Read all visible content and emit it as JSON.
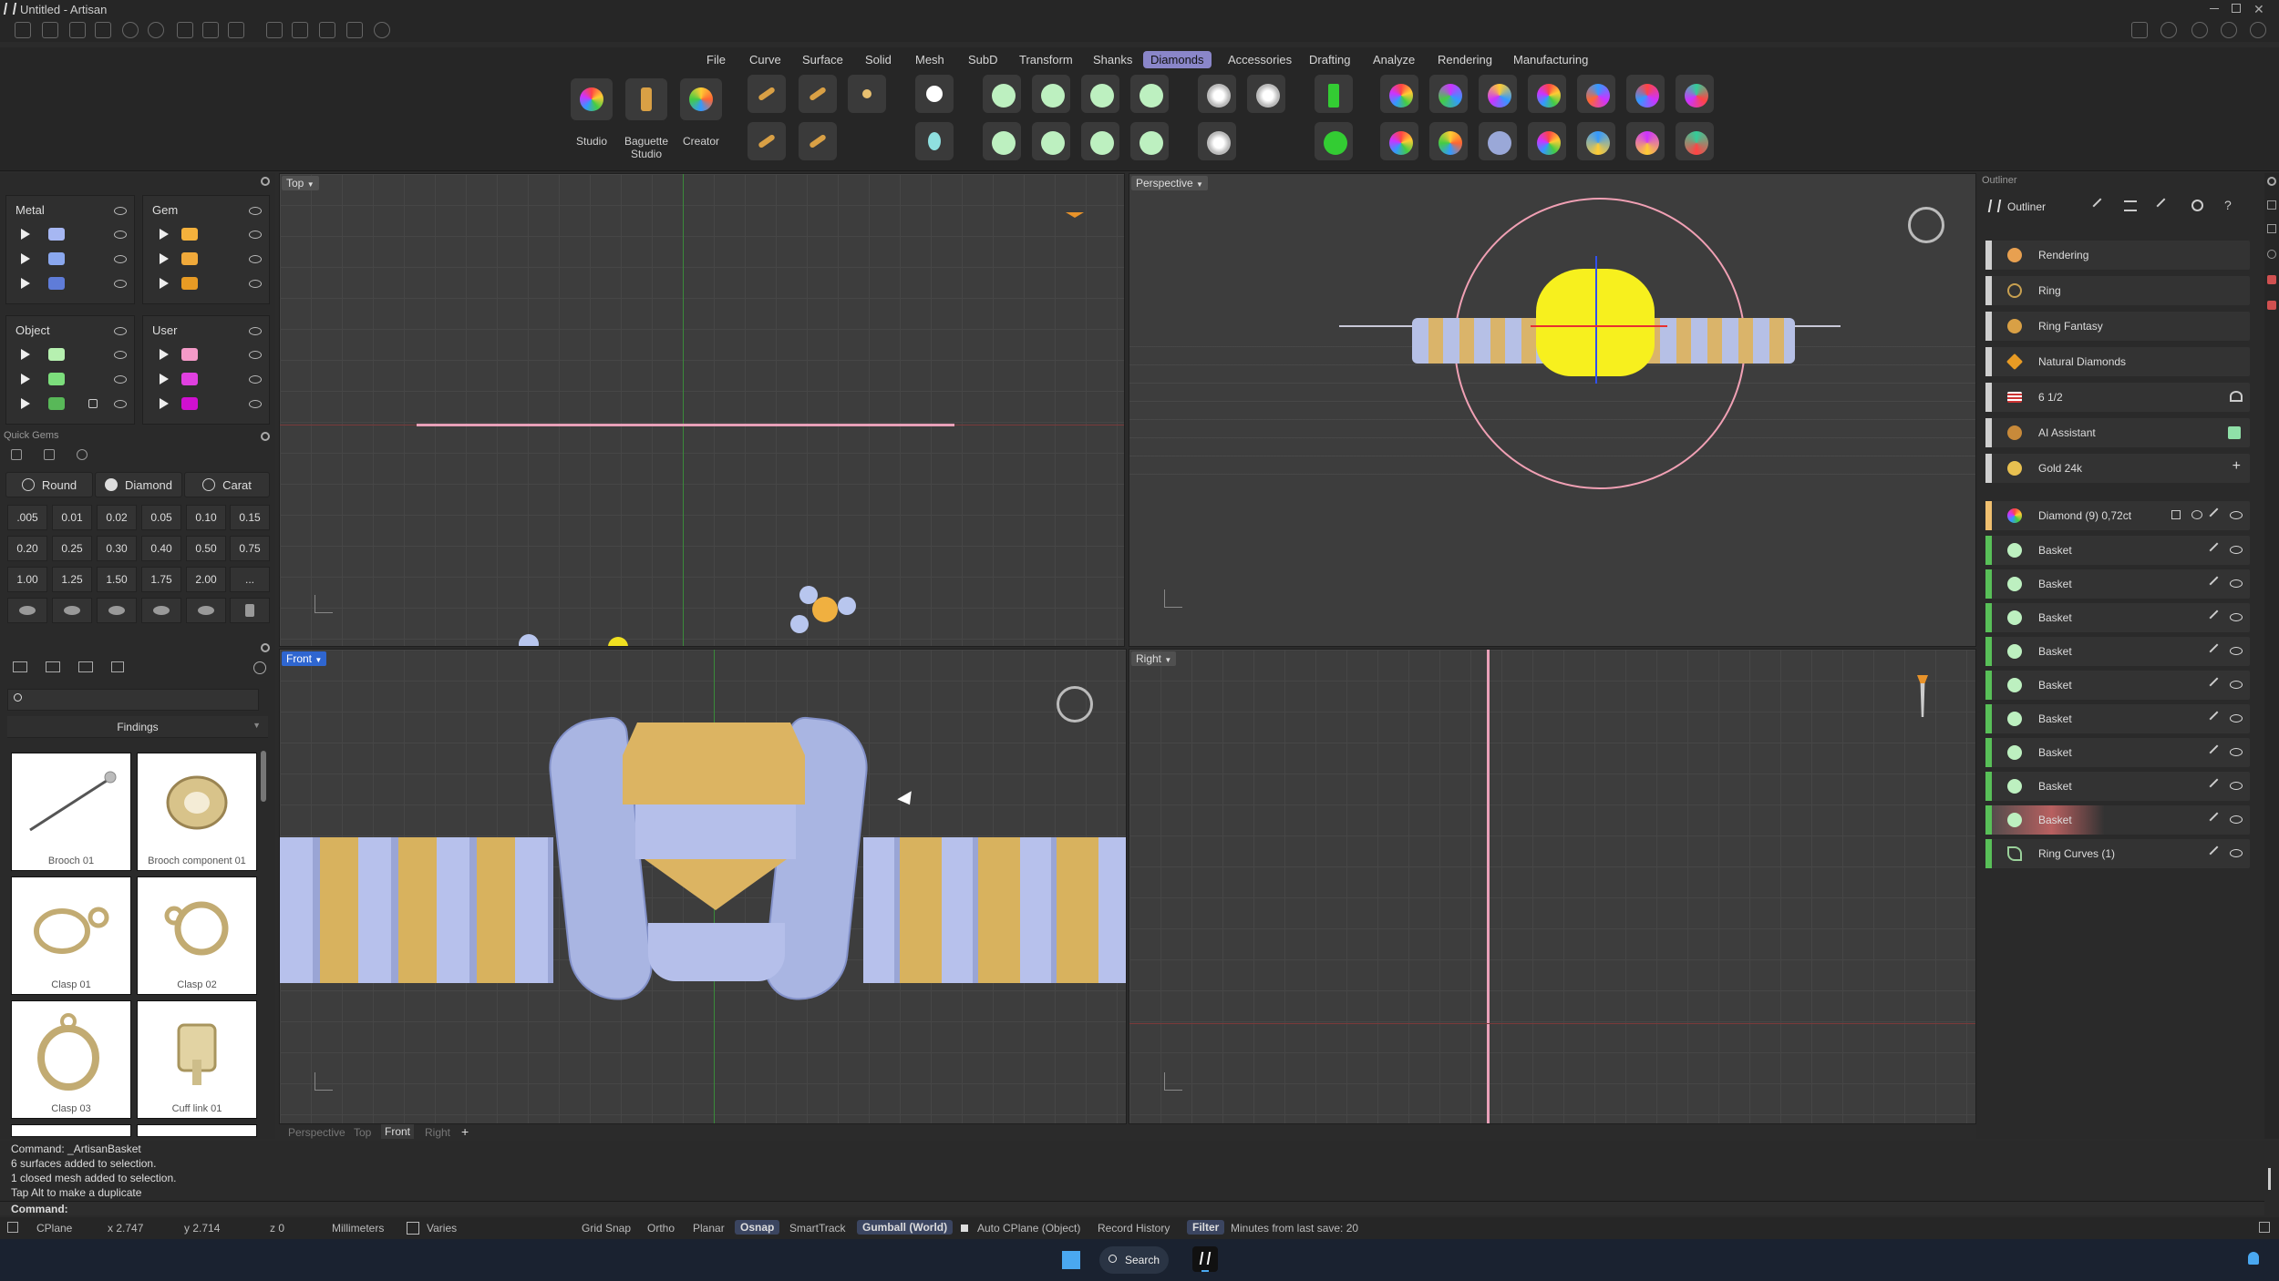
{
  "window": {
    "title": "Untitled - Artisan"
  },
  "menu": {
    "items": [
      "File",
      "Curve",
      "Surface",
      "Solid",
      "Mesh",
      "SubD",
      "Transform",
      "Shanks",
      "Diamonds",
      "Accessories",
      "Drafting",
      "Analyze",
      "Rendering",
      "Manufacturing"
    ],
    "active": "Diamonds"
  },
  "ribbon": {
    "studio": "Studio",
    "baguette_studio": "Baguette\nStudio",
    "creator": "Creator"
  },
  "layers": {
    "metal": "Metal",
    "gem": "Gem",
    "object": "Object",
    "user": "User",
    "metal_colors": [
      "#a6b7f2",
      "#8aa7ee",
      "#5f7cd8"
    ],
    "gem_colors": [
      "#f4b13c",
      "#f0a93a",
      "#e89b24"
    ],
    "object_colors": [
      "#b6f0b0",
      "#7cde7c",
      "#58b858"
    ],
    "user_colors": [
      "#f49ac8",
      "#e040e0",
      "#d010d0"
    ]
  },
  "quick_gems": {
    "title": "Quick Gems",
    "shape": "Round",
    "type": "Diamond",
    "unit": "Carat",
    "sizes": [
      ".005",
      "0.01",
      "0.02",
      "0.05",
      "0.10",
      "0.15",
      "0.20",
      "0.25",
      "0.30",
      "0.40",
      "0.50",
      "0.75",
      "1.00",
      "1.25",
      "1.50",
      "1.75",
      "2.00",
      "..."
    ]
  },
  "library": {
    "category": "Findings",
    "items": [
      "Brooch 01",
      "Brooch component 01",
      "Clasp 01",
      "Clasp 02",
      "Clasp 03",
      "Cuff link 01"
    ]
  },
  "viewports": {
    "top": "Top",
    "perspective": "Perspective",
    "front": "Front",
    "right": "Right"
  },
  "viewport_tabs": {
    "items": [
      "Perspective",
      "Top",
      "Front",
      "Right"
    ],
    "active": "Front",
    "add": "+"
  },
  "outliner": {
    "panel_title": "Outliner",
    "header": "Outliner",
    "settings": [
      {
        "label": "Rendering",
        "icon": "palette-icon"
      },
      {
        "label": "Ring",
        "icon": "ring-icon"
      },
      {
        "label": "Ring Fantasy",
        "icon": "ring-fantasy-icon"
      },
      {
        "label": "Natural Diamonds",
        "icon": "diamond-icon"
      },
      {
        "label": "6 1/2",
        "icon": "us-flag-icon"
      },
      {
        "label": "AI Assistant",
        "icon": "ai-assistant-icon"
      },
      {
        "label": "Gold 24k",
        "icon": "gold-icon"
      }
    ],
    "group": "Diamond (9) 0,72ct",
    "objects": [
      "Basket",
      "Basket",
      "Basket",
      "Basket",
      "Basket",
      "Basket",
      "Basket",
      "Basket",
      "Basket"
    ],
    "curves": "Ring Curves (1)"
  },
  "command_history": [
    "Command: _ArtisanBasket",
    "6 surfaces added to selection.",
    "1 closed mesh added to selection.",
    "Tap Alt to make a duplicate"
  ],
  "command_prompt": "Command:",
  "status": {
    "cplane": "CPlane",
    "x": "x 2.747",
    "y": "y 2.714",
    "z": "z 0",
    "units": "Millimeters",
    "layer": "Varies",
    "grid_snap": "Grid Snap",
    "ortho": "Ortho",
    "planar": "Planar",
    "osnap": "Osnap",
    "smarttrack": "SmartTrack",
    "gumball": "Gumball (World)",
    "auto_cplane": "Auto CPlane (Object)",
    "record_history": "Record History",
    "filter": "Filter",
    "last_save": "Minutes from last save: 20"
  },
  "taskbar": {
    "search": "Search"
  }
}
